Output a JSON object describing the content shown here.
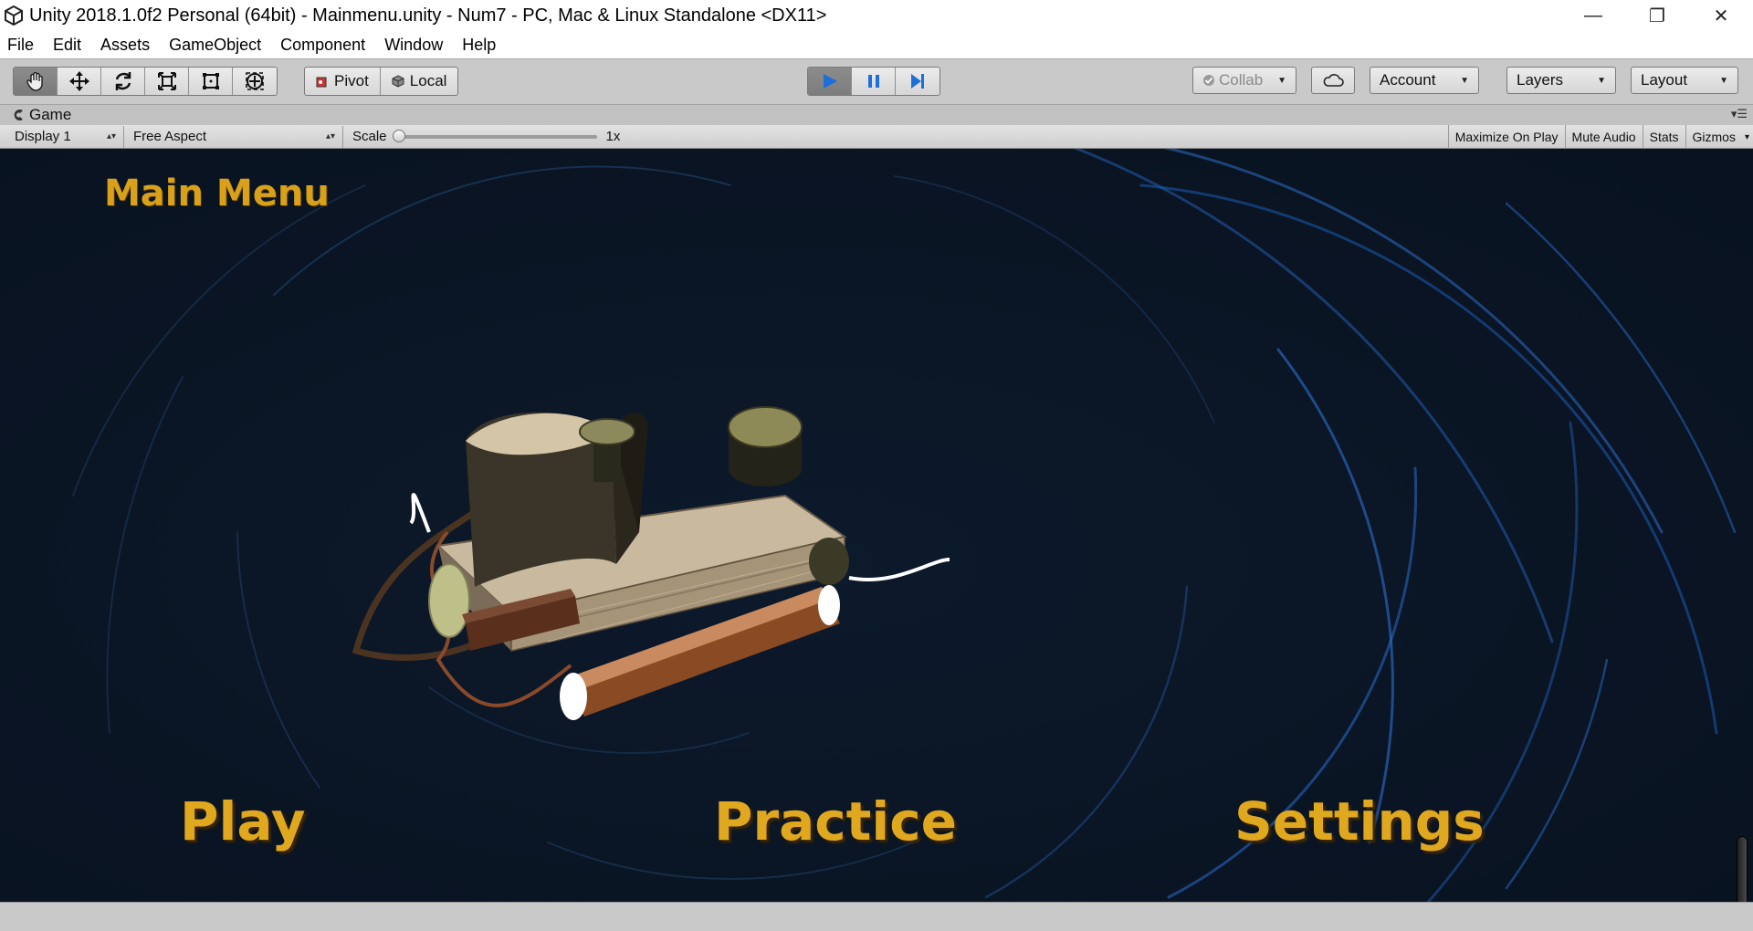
{
  "window": {
    "title": "Unity 2018.1.0f2 Personal (64bit) - Mainmenu.unity - Num7 - PC, Mac & Linux Standalone <DX11>",
    "minimize_glyph": "—",
    "restore_glyph": "❐",
    "close_glyph": "✕"
  },
  "menu": {
    "file": "File",
    "edit": "Edit",
    "assets": "Assets",
    "gameobject": "GameObject",
    "component": "Component",
    "window": "Window",
    "help": "Help"
  },
  "toolbar": {
    "transform_tools": [
      "hand-icon",
      "move-icon",
      "rotate-icon",
      "scale-icon",
      "rect-icon",
      "transform-icon"
    ],
    "pivot_label": "Pivot",
    "local_label": "Local",
    "collab_label": "Collab",
    "account_label": "Account",
    "layers_label": "Layers",
    "layout_label": "Layout",
    "play_color": "#1e6fd9"
  },
  "game_tab": {
    "label": "Game"
  },
  "game_bar": {
    "display": "Display 1",
    "aspect": "Free Aspect",
    "scale_label": "Scale",
    "scale_value": "1x",
    "scale_level": 0,
    "maximize_on_play": "Maximize On Play",
    "mute_audio": "Mute Audio",
    "stats": "Stats",
    "gizmos": "Gizmos"
  },
  "game": {
    "title": "Main Menu",
    "play": "Play",
    "practice": "Practice",
    "settings": "Settings",
    "text_color": "#e0a81e"
  }
}
